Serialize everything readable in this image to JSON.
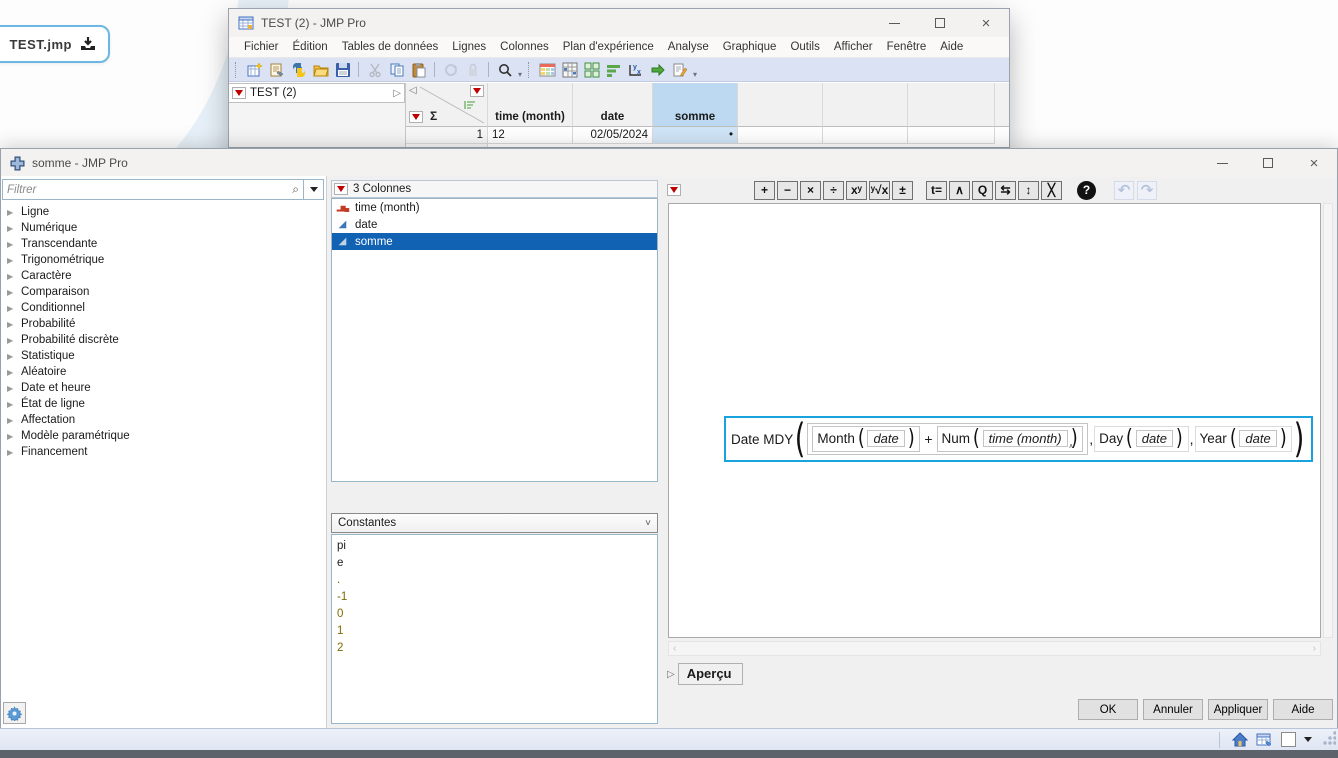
{
  "home": {
    "file_tab_label": "TEST.jmp"
  },
  "test_window": {
    "title": "TEST (2) - JMP Pro",
    "menus": [
      "Fichier",
      "Édition",
      "Tables de données",
      "Lignes",
      "Colonnes",
      "Plan d'expérience",
      "Analyse",
      "Graphique",
      "Outils",
      "Afficher",
      "Fenêtre",
      "Aide"
    ],
    "panel_title": "TEST (2)",
    "table": {
      "sigma": "Σ",
      "columns": [
        "time (month)",
        "date",
        "somme"
      ],
      "selected_column": "somme",
      "row_number": "1",
      "row_values": {
        "time": "12",
        "date": "02/05/2024",
        "somme": "•"
      }
    }
  },
  "formula_window": {
    "title": "somme - JMP Pro",
    "filter_placeholder": "Filtrer",
    "function_categories": [
      "Ligne",
      "Numérique",
      "Transcendante",
      "Trigonométrique",
      "Caractère",
      "Comparaison",
      "Conditionnel",
      "Probabilité",
      "Probabilité discrète",
      "Statistique",
      "Aléatoire",
      "Date et heure",
      "État de ligne",
      "Affectation",
      "Modèle paramétrique",
      "Financement"
    ],
    "columns_panel": {
      "header": "3 Colonnes",
      "items": [
        {
          "label": "time (month)",
          "cls": "c-bars"
        },
        {
          "label": "date",
          "cls": "c-tri"
        },
        {
          "label": "somme",
          "cls": "c-tripale",
          "selected": true
        }
      ]
    },
    "constants_panel": {
      "selector_value": "Constantes",
      "items": [
        {
          "label": "pi"
        },
        {
          "label": "e"
        },
        {
          "label": ".",
          "cls": "num"
        },
        {
          "label": "-1",
          "cls": "num"
        },
        {
          "label": "0",
          "cls": "num"
        },
        {
          "label": "1",
          "cls": "num"
        },
        {
          "label": "2",
          "cls": "num"
        }
      ]
    },
    "fx_toolbar": {
      "group1": [
        "+",
        "−",
        "×",
        "÷",
        "xʸ",
        "ʸ√x",
        "±"
      ],
      "group2": [
        "t=",
        "∧",
        "Q",
        "⇆",
        "↕",
        "╳"
      ],
      "help": "?",
      "undo": "↶",
      "redo": "↷"
    },
    "formula": {
      "head": "Date MDY",
      "fn_month": "Month",
      "arg_month": "date",
      "op_plus": "+",
      "fn_num": "Num",
      "arg_num": "time (month)",
      "comma": ",",
      "fn_day": "Day",
      "arg_day": "date",
      "fn_year": "Year",
      "arg_year": "date"
    },
    "preview_label": "Aperçu",
    "buttons": {
      "ok": "OK",
      "cancel": "Annuler",
      "apply": "Appliquer",
      "help": "Aide"
    }
  },
  "icons": [
    "new-data-table-icon",
    "journal-icon",
    "python-icon",
    "open-icon",
    "save-icon",
    "cut-icon",
    "copy-icon",
    "paste-icon",
    "refresh-icon",
    "lock-icon",
    "search-icon",
    "data-table-icon",
    "formula-column-icon",
    "tile-windows-icon",
    "sort-icon",
    "yx-label-icon",
    "run-script-icon",
    "script-editor-icon",
    "gear-icon",
    "home-icon",
    "window-table-icon",
    "download-icon"
  ],
  "colors": {
    "accent_selection": "#1262b4",
    "formula_highlight": "#18a3dd",
    "column_highlight": "#bcd9f1",
    "marker_red": "#c00000"
  }
}
